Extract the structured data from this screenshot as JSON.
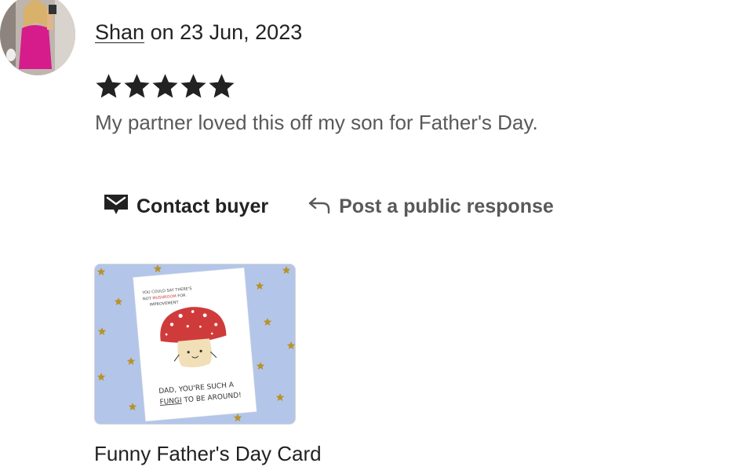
{
  "review": {
    "reviewer_name": "Shan",
    "date_text": " on 23 Jun, 2023",
    "rating": 5,
    "rating_max": 5,
    "text": "My partner loved this off my son for Father's Day."
  },
  "actions": {
    "contact_label": "Contact buyer",
    "contact_icon": "envelope-icon",
    "respond_label": "Post a public response",
    "respond_icon": "reply-arrow-icon"
  },
  "listing": {
    "title": "Funny Father's Day Card",
    "card_top_text": [
      "YOU COULD SAY THERE'S",
      "NOT",
      "MUSHROOM",
      "FOR",
      "IMPROVEMENT"
    ],
    "card_bottom_text": [
      "DAD, YOU'RE SUCH A",
      "FUNGI",
      "TO BE AROUND!"
    ]
  },
  "colors": {
    "text": "#222222",
    "muted": "#595959",
    "star": "#222222",
    "image_background": "#b3c6e9",
    "mushroom_cap": "#cf3b3b",
    "gold_star": "#b8922a"
  }
}
